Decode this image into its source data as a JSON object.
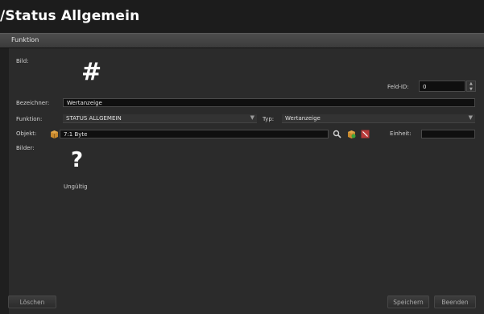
{
  "header": {
    "title": "/Status Allgemein"
  },
  "section": {
    "title": "Funktion"
  },
  "form": {
    "bild_label": "Bild:",
    "bild_icon": "hash-icon",
    "feld_id_label": "Feld-ID:",
    "feld_id_value": "0",
    "bezeichner_label": "Bezeichner:",
    "bezeichner_value": "Wertanzeige",
    "funktion_label": "Funktion:",
    "funktion_value": "STATUS ALLGEMEIN",
    "typ_label": "Typ:",
    "typ_value": "Wertanzeige",
    "objekt_label": "Objekt:",
    "objekt_value": "7:1 Byte",
    "einheit_label": "Einheit:",
    "einheit_value": "",
    "bilder_label": "Bilder:",
    "bilder_item_label": "Ungültig",
    "bilder_item_icon": "question-mark-icon"
  },
  "buttons": {
    "loeschen": "Löschen",
    "speichern": "Speichern",
    "beenden": "Beenden"
  },
  "colors": {
    "background": "#1f1f1f",
    "panel": "#2b2b2b",
    "field": "#0f0f0f",
    "accent_red": "#b83a3a"
  }
}
